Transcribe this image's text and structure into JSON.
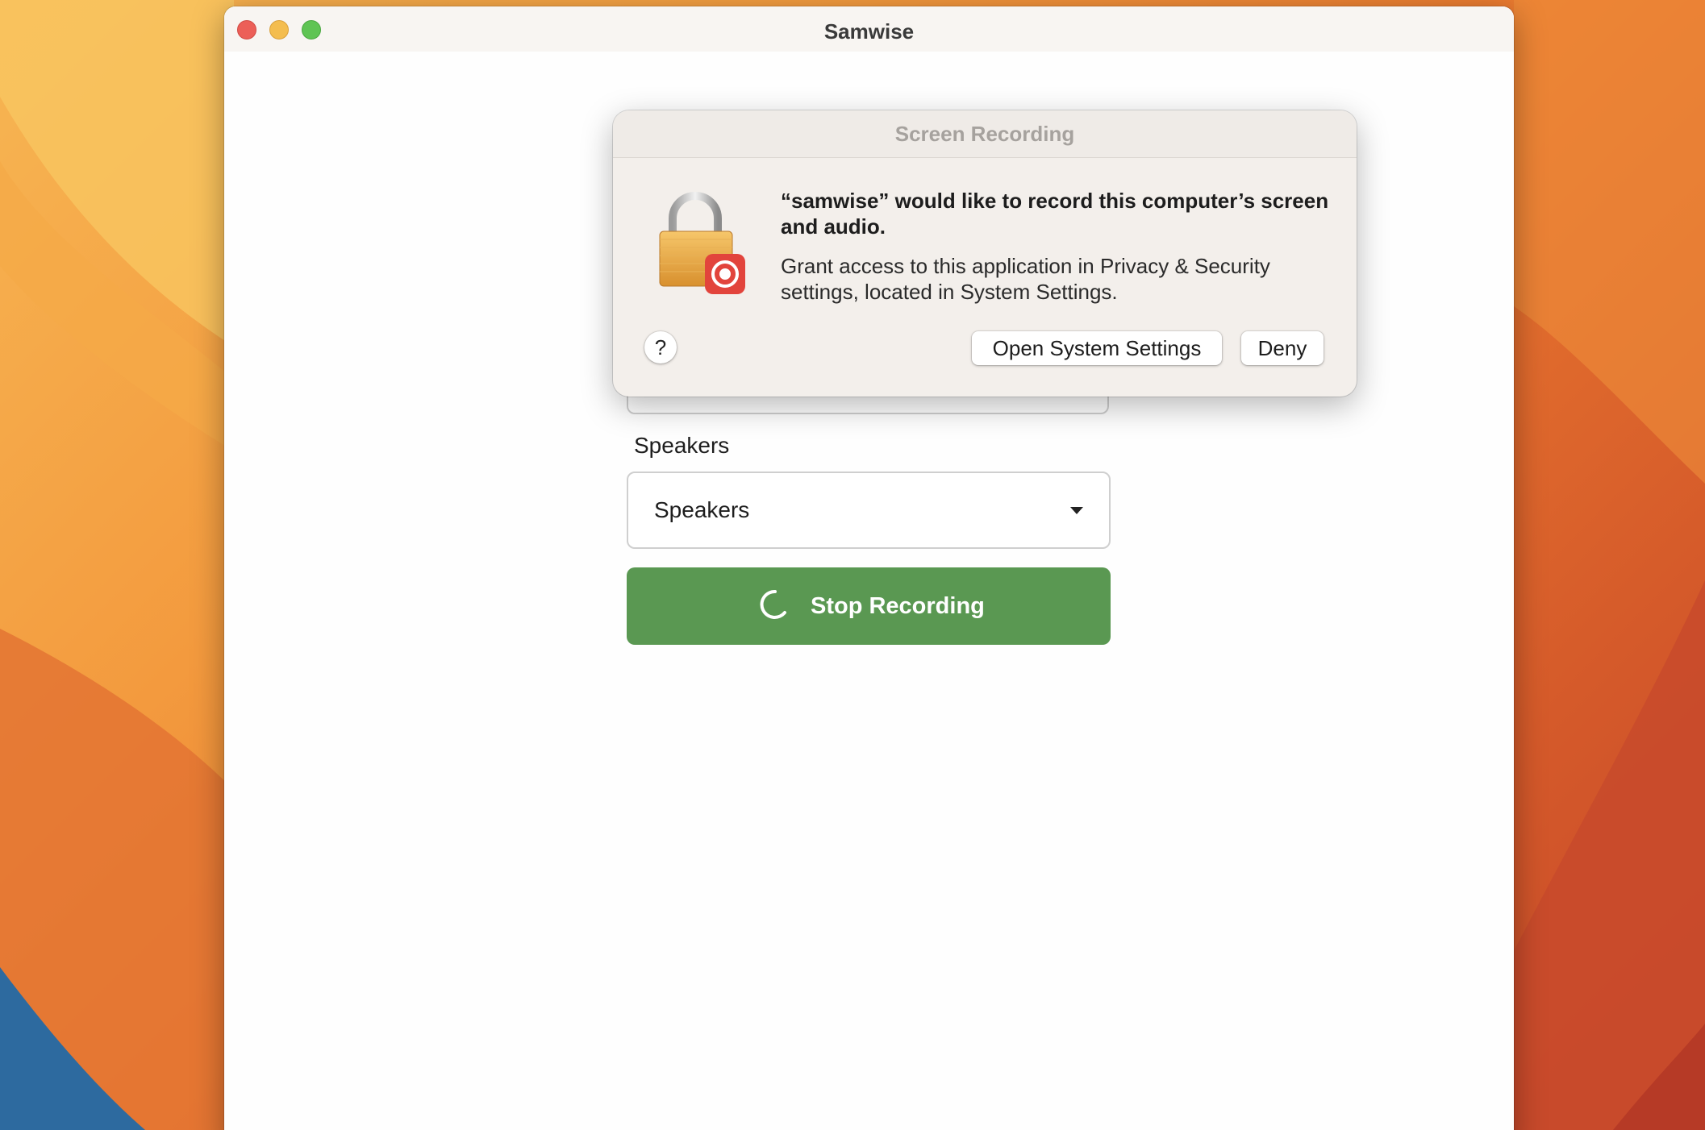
{
  "window": {
    "title": "Samwise"
  },
  "form": {
    "speakers_label": "Speakers",
    "speakers_select": {
      "selected": "Speakers"
    },
    "record_button": {
      "label": "Stop Recording"
    }
  },
  "dialog": {
    "title": "Screen Recording",
    "heading": "“samwise” would like to record this computer’s screen and audio.",
    "body": "Grant access to this application in Privacy & Security settings, located in System Settings.",
    "help_label": "?",
    "open_settings_label": "Open System Settings",
    "deny_label": "Deny",
    "icon": "lock-with-record-icon"
  },
  "colors": {
    "record_button": "#5a9852",
    "close": "#ec5f58",
    "minimize": "#f4bd4f",
    "zoom": "#5fc454"
  }
}
